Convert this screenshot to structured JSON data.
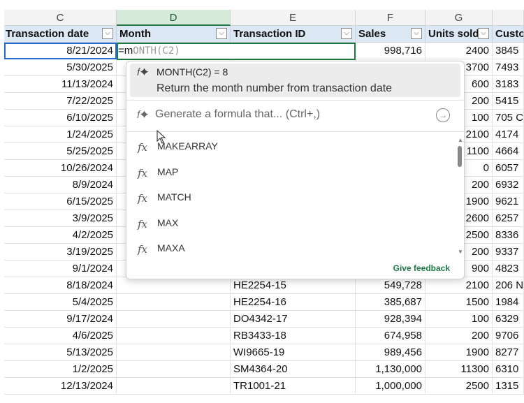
{
  "columns": [
    "C",
    "D",
    "E",
    "F",
    "G"
  ],
  "headers": [
    "Transaction date",
    "Month",
    "Transaction ID",
    "Sales",
    "Units sold",
    "Custo"
  ],
  "editor": {
    "typed": "=m",
    "ghost": "ONTH(C2)"
  },
  "first_row": {
    "date": "8/21/2024",
    "sales": "998,716",
    "units": "2400",
    "cust": "3845"
  },
  "rows": [
    {
      "date": "5/30/2025",
      "id": "",
      "sales": "",
      "units": "3700",
      "cust": "7493"
    },
    {
      "date": "11/13/2024",
      "id": "",
      "sales": "",
      "units": "600",
      "cust": "3183"
    },
    {
      "date": "7/22/2025",
      "id": "",
      "sales": "",
      "units": "200",
      "cust": "5415"
    },
    {
      "date": "6/10/2025",
      "id": "",
      "sales": "",
      "units": "100",
      "cust": "705 C"
    },
    {
      "date": "1/24/2025",
      "id": "",
      "sales": "",
      "units": "2100",
      "cust": "4174"
    },
    {
      "date": "5/25/2025",
      "id": "",
      "sales": "",
      "units": "1100",
      "cust": "4664"
    },
    {
      "date": "10/26/2024",
      "id": "",
      "sales": "",
      "units": "0",
      "cust": "6057"
    },
    {
      "date": "8/9/2024",
      "id": "",
      "sales": "",
      "units": "200",
      "cust": "6932"
    },
    {
      "date": "6/15/2025",
      "id": "",
      "sales": "",
      "units": "1900",
      "cust": "9621"
    },
    {
      "date": "3/9/2025",
      "id": "",
      "sales": "",
      "units": "2600",
      "cust": "6257"
    },
    {
      "date": "4/2/2025",
      "id": "",
      "sales": "",
      "units": "2500",
      "cust": "8336"
    },
    {
      "date": "3/19/2025",
      "id": "",
      "sales": "",
      "units": "200",
      "cust": "9337"
    },
    {
      "date": "9/1/2024",
      "id": "",
      "sales": "",
      "units": "900",
      "cust": "4823"
    },
    {
      "date": "8/18/2024",
      "id": "HE2254-15",
      "sales": "549,728",
      "units": "2100",
      "cust": "206 N"
    },
    {
      "date": "5/4/2025",
      "id": "HE2254-16",
      "sales": "385,687",
      "units": "1500",
      "cust": "1984"
    },
    {
      "date": "9/17/2024",
      "id": "DO4342-17",
      "sales": "928,394",
      "units": "100",
      "cust": "6329"
    },
    {
      "date": "4/6/2025",
      "id": "RB3433-18",
      "sales": "674,958",
      "units": "200",
      "cust": "9706"
    },
    {
      "date": "5/13/2025",
      "id": "WI9665-19",
      "sales": "989,456",
      "units": "1900",
      "cust": "8277"
    },
    {
      "date": "1/2/2025",
      "id": "SM4364-20",
      "sales": "1,130,000",
      "units": "11300",
      "cust": "6310"
    },
    {
      "date": "12/13/2024",
      "id": "TR1001-21",
      "sales": "1,000,000",
      "units": "2500",
      "cust": "1315"
    }
  ],
  "popup": {
    "suggestion_title": "MONTH(C2) = 8",
    "suggestion_desc": "Return the month number from transaction date",
    "generate": "Generate a formula that... (Ctrl+,)",
    "functions": [
      "MAKEARRAY",
      "MAP",
      "MATCH",
      "MAX",
      "MAXA"
    ],
    "feedback": "Give feedback"
  },
  "icons": {
    "sparkle_fx": "✨fx",
    "fx": "fx",
    "arrow": "→"
  },
  "colors": {
    "accent": "#1e7a43",
    "header_bg": "#dde8f5"
  }
}
